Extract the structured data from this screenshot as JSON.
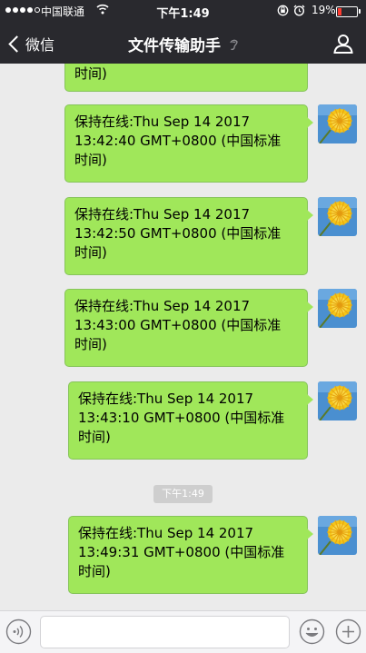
{
  "status_bar": {
    "carrier": "中国联通",
    "time": "下午1:49",
    "battery": "19%",
    "battery_level": 0.19
  },
  "nav": {
    "back_label": "微信",
    "title": "文件传输助手"
  },
  "chat": {
    "clipped_top_line": "时间)",
    "messages": [
      {
        "lines": [
          "保持在线:Thu Sep 14 2017",
          "13:42:40 GMT+0800 (中国标准",
          "时间)"
        ]
      },
      {
        "lines": [
          "保持在线:Thu Sep 14 2017",
          "13:42:50 GMT+0800 (中国标准",
          "时间)"
        ]
      },
      {
        "lines": [
          "保持在线:Thu Sep 14 2017",
          "13:43:00 GMT+0800 (中国标准",
          "时间)"
        ]
      },
      {
        "lines": [
          "保持在线:Thu Sep 14 2017",
          "13:43:10 GMT+0800 (中国标准",
          "时间)"
        ]
      },
      {
        "lines": [
          "保持在线:Thu Sep 14 2017",
          "13:49:31 GMT+0800 (中国标准",
          "时间)"
        ]
      }
    ],
    "time_separator": "下午1:49"
  },
  "colors": {
    "bubble": "#a0e75a",
    "nav_background": "#29292e",
    "chat_background": "#ebebeb"
  },
  "icons": [
    "wifi-icon",
    "lock-rotation-icon",
    "alarm-icon",
    "battery-icon",
    "back-chevron-icon",
    "ear-icon",
    "profile-icon",
    "avatar-dandelion-icon",
    "voice-icon",
    "emoji-icon",
    "plus-icon"
  ]
}
